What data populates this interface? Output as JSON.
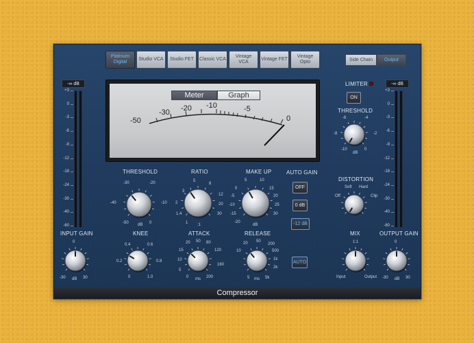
{
  "models": [
    {
      "label": "Platinum Digital",
      "active": true
    },
    {
      "label": "Studio VCA",
      "active": false
    },
    {
      "label": "Studio FET",
      "active": false
    },
    {
      "label": "Classic VCA",
      "active": false
    },
    {
      "label": "Vintage VCA",
      "active": false
    },
    {
      "label": "Vintage FET",
      "active": false
    },
    {
      "label": "Vintage Opto",
      "active": false
    }
  ],
  "sidechain": {
    "side_chain": "Side Chain",
    "output": "Output"
  },
  "meter_view": {
    "meter": "Meter",
    "graph": "Graph"
  },
  "vu_scale": [
    "-50",
    "-30",
    "-20",
    "-10",
    "-5",
    "0"
  ],
  "input_meter": {
    "readout": "-∞ dB",
    "scale": [
      "+3",
      "0",
      "-3",
      "-6",
      "-9",
      "-12",
      "-18",
      "-24",
      "-30",
      "-40",
      "-60"
    ],
    "label": "INPUT GAIN"
  },
  "output_meter": {
    "readout": "-∞ dB",
    "scale": [
      "+3",
      "0",
      "-3",
      "-6",
      "-9",
      "-12",
      "-18",
      "-24",
      "-30",
      "-40",
      "-60"
    ],
    "label": "OUTPUT GAIN"
  },
  "knobs": {
    "threshold": {
      "label": "THRESHOLD",
      "unit": "dB",
      "ticks": [
        "-30",
        "-20",
        "-40",
        "-10",
        "-50",
        "0"
      ],
      "value": -20
    },
    "ratio": {
      "label": "RATIO",
      "unit": ":1",
      "ticks": [
        "5",
        "8",
        "3",
        "12",
        "2",
        "20",
        "1.4",
        "30",
        "1"
      ],
      "value": 3
    },
    "makeup": {
      "label": "MAKE UP",
      "unit": "dB",
      "ticks": [
        "5",
        "10",
        "0",
        "15",
        "-5",
        "20",
        "-10",
        "25",
        "-15",
        "30",
        "-20"
      ],
      "value": 5
    },
    "knee": {
      "label": "KNEE",
      "ticks": [
        "0.4",
        "0.6",
        "0.2",
        "0.8",
        "0",
        "1.0"
      ],
      "value": 0.2
    },
    "attack": {
      "label": "ATTACK",
      "unit": "ms",
      "ticks": [
        "20",
        "50",
        "80",
        "15",
        "120",
        "10",
        "160",
        "5",
        "200",
        "0"
      ],
      "value": 20
    },
    "release": {
      "label": "RELEASE",
      "unit": "ms",
      "ticks": [
        "20",
        "50",
        "200",
        "10",
        "500",
        "1k",
        "2k",
        "5",
        "5k"
      ],
      "value": 50
    },
    "input_gain": {
      "ticks": [
        "0",
        "-30",
        "30"
      ],
      "unit": "dB",
      "value": 0
    },
    "limiter_threshold": {
      "label": "THRESHOLD",
      "unit": "dB",
      "ticks": [
        "-6",
        "-4",
        "-8",
        "-2",
        "-10",
        "0"
      ],
      "value": -6
    },
    "distortion": {
      "label": "DISTORTION",
      "ticks": [
        "Soft",
        "Hard",
        "Off",
        "Clip"
      ],
      "value": "Off"
    },
    "mix": {
      "label": "MIX",
      "ticks": [
        "1:1",
        "Input",
        "Output"
      ],
      "value": "1:1"
    },
    "output_gain": {
      "ticks": [
        "0",
        "-30",
        "30"
      ],
      "unit": "dB",
      "value": 0
    }
  },
  "auto_gain": {
    "label": "AUTO GAIN",
    "options": [
      "OFF",
      "0 dB",
      "-12 dB"
    ],
    "selected": "-12 dB"
  },
  "auto_release": {
    "label": "AUTO",
    "active": true
  },
  "limiter": {
    "label": "LIMITER",
    "on_label": "ON"
  },
  "footer": {
    "title": "Compressor"
  }
}
